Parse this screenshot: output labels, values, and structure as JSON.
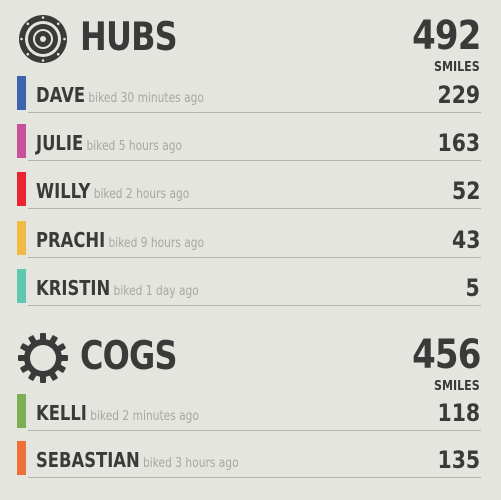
{
  "unit_label": "SMILES",
  "teams": [
    {
      "name": "HUBS",
      "icon": "hub-icon",
      "total": "492",
      "members": [
        {
          "name": "DAVE",
          "when": "biked 30 minutes ago",
          "value": "229",
          "color": "#3d64ae"
        },
        {
          "name": "JULIE",
          "when": "biked 5 hours ago",
          "value": "163",
          "color": "#c7519b"
        },
        {
          "name": "WILLY",
          "when": "biked 2 hours ago",
          "value": "52",
          "color": "#e92534"
        },
        {
          "name": "PRACHI",
          "when": "biked 9 hours ago",
          "value": "43",
          "color": "#f0ba45"
        },
        {
          "name": "KRISTIN",
          "when": "biked 1 day ago",
          "value": "5",
          "color": "#5ec9ae"
        }
      ]
    },
    {
      "name": "COGS",
      "icon": "cog-icon",
      "total": "456",
      "members": [
        {
          "name": "KELLI",
          "when": "biked 2 minutes ago",
          "value": "118",
          "color": "#7cae55"
        },
        {
          "name": "SEBASTIAN",
          "when": "biked 3 hours ago",
          "value": "135",
          "color": "#ec7037"
        }
      ]
    }
  ]
}
